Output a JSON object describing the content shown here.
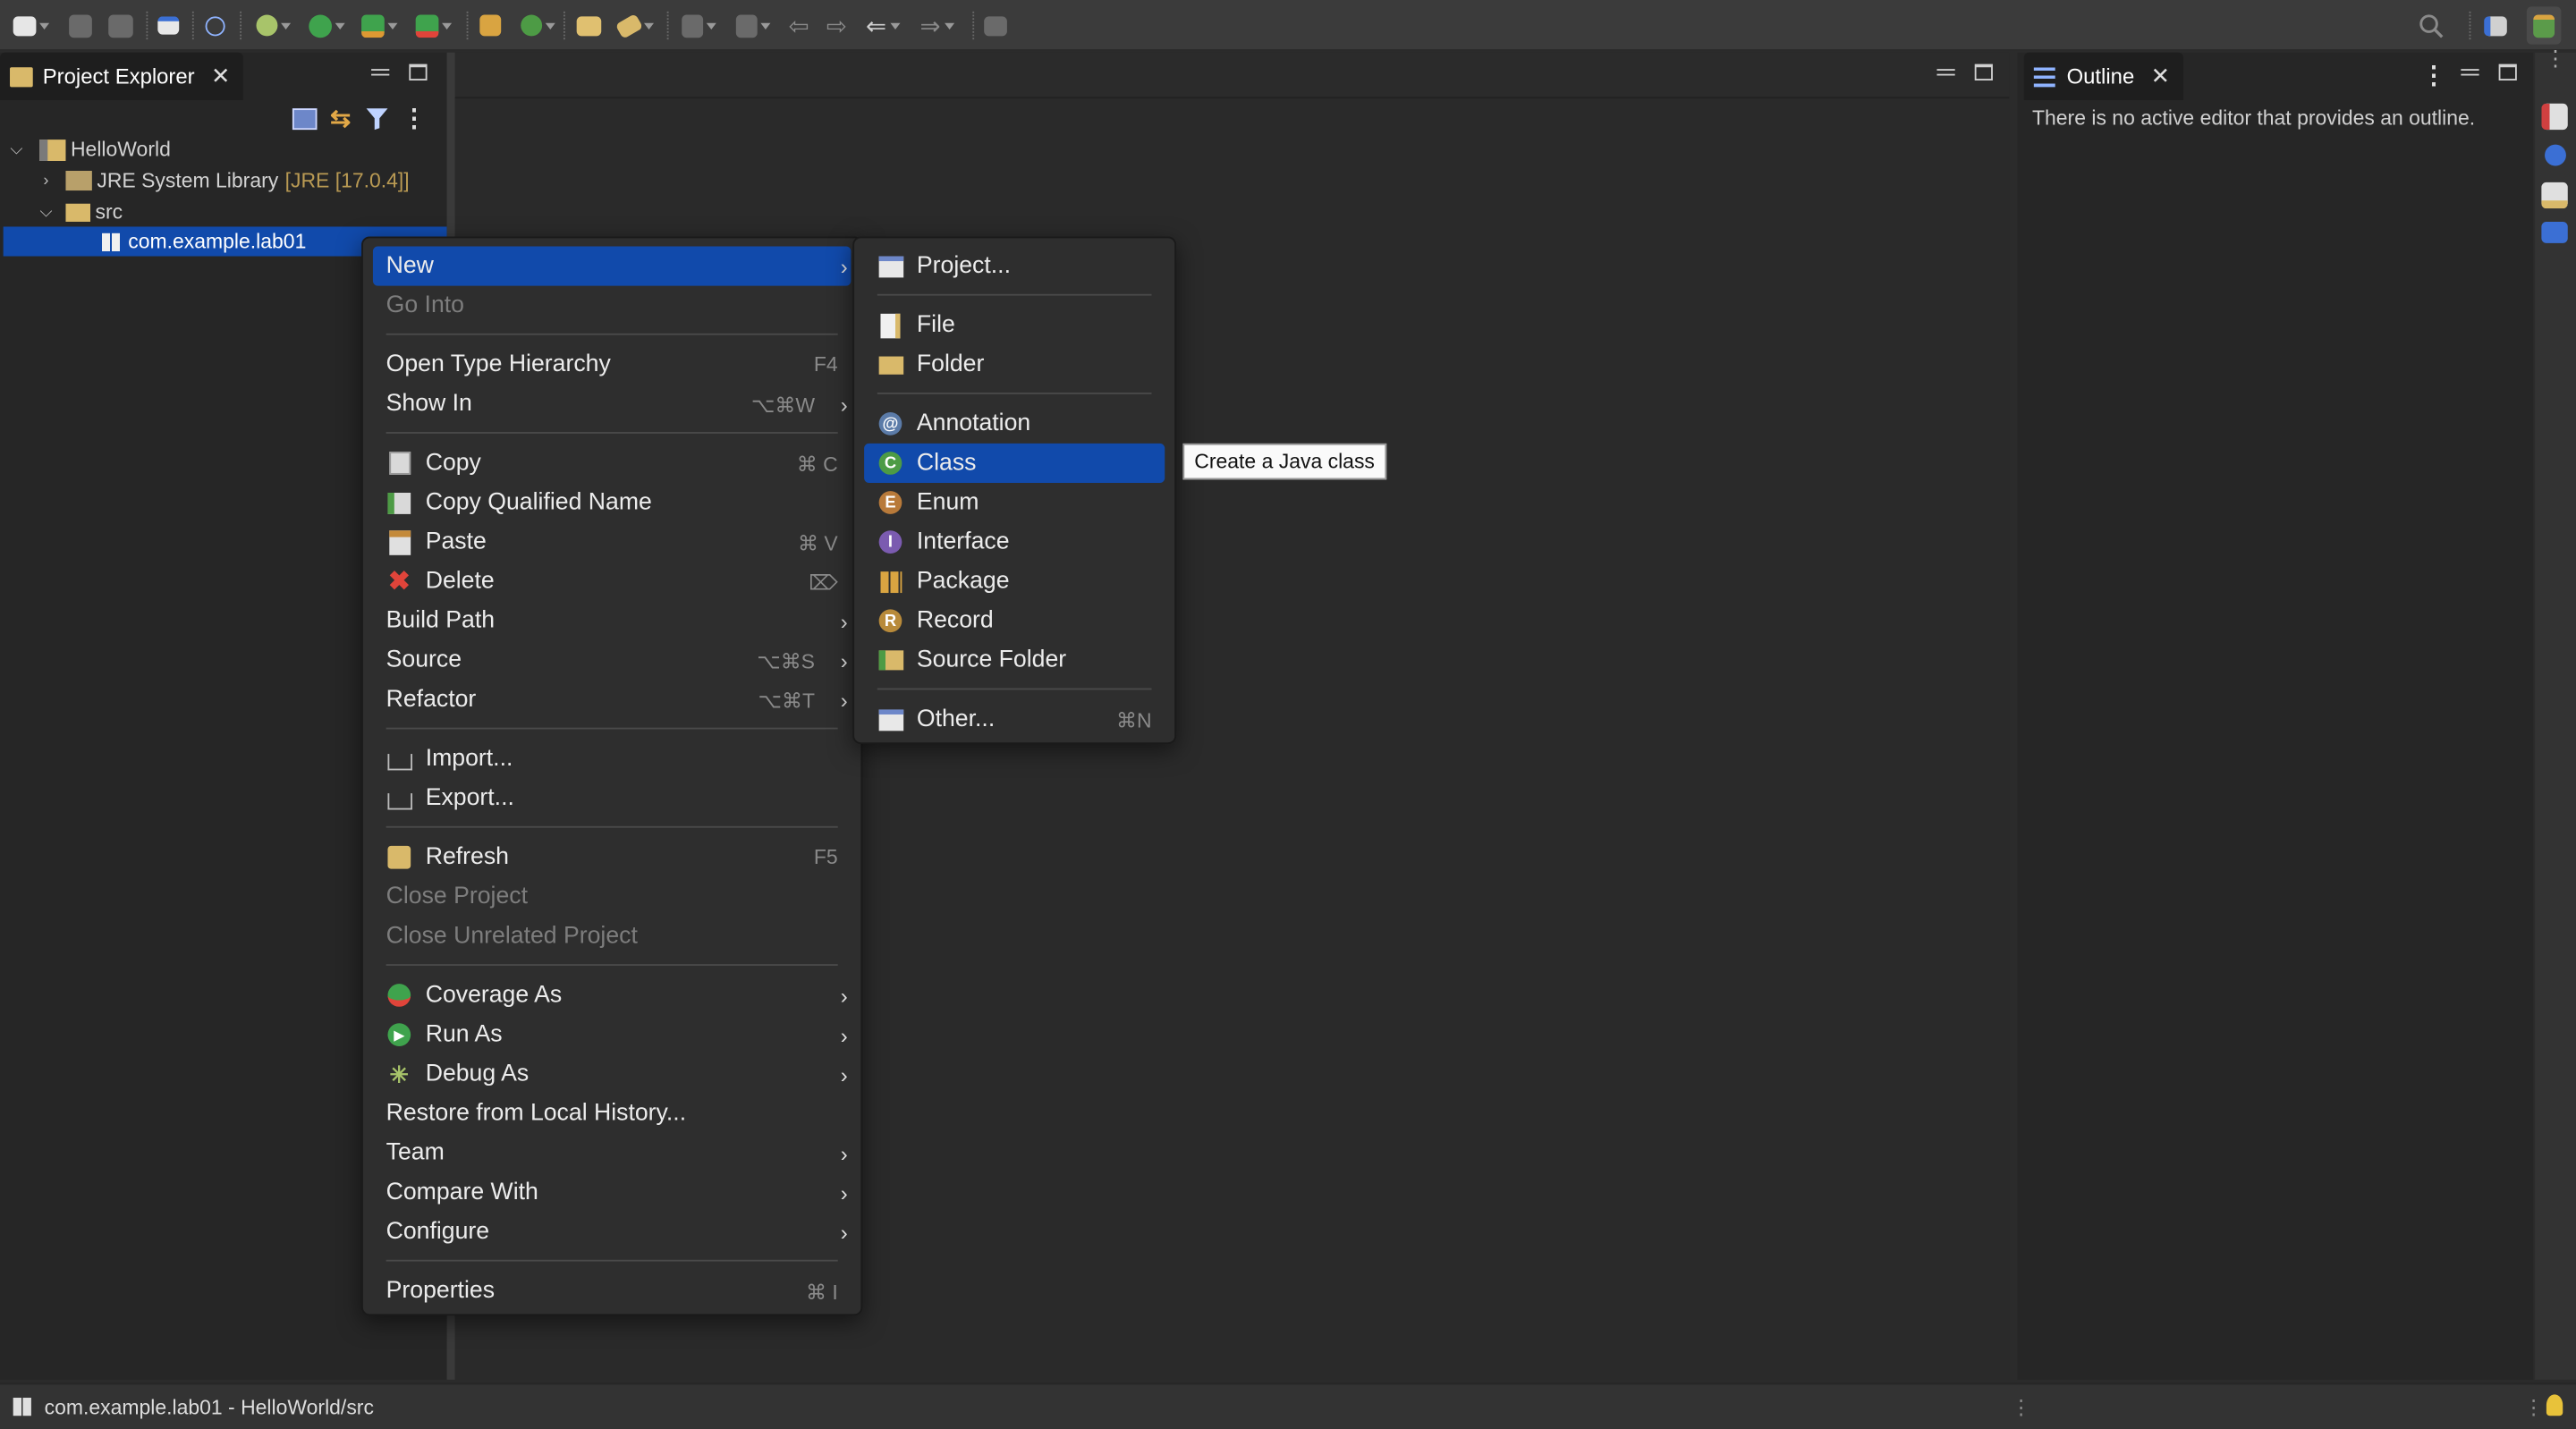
{
  "toolbar": {
    "icons": [
      "new-wizard-icon",
      "save-icon",
      "save-all-icon",
      "window-icon",
      "skip-breakpoints-icon",
      "debug-icon",
      "run-icon",
      "coverage-icon",
      "external-tools-icon",
      "new-java-package-icon",
      "new-java-class-icon",
      "open-type-icon",
      "search-icon-tool",
      "annotation-nav-icon",
      "next-annotation-icon",
      "back-icon",
      "forward-icon",
      "last-edit-icon",
      "pin-editor-icon"
    ]
  },
  "project_explorer": {
    "tab_label": "Project Explorer",
    "tree": [
      {
        "label": "HelloWorld",
        "extra": ""
      },
      {
        "label": "JRE System Library",
        "extra": "[JRE [17.0.4]]"
      },
      {
        "label": "src",
        "extra": ""
      },
      {
        "label": "com.example.lab01",
        "extra": ""
      }
    ]
  },
  "outline": {
    "tab_label": "Outline",
    "message": "There is no active editor that provides an outline."
  },
  "context_menu": {
    "new": "New",
    "go_into": "Go Into",
    "open_type_hierarchy": "Open Type Hierarchy",
    "open_type_hierarchy_sc": "F4",
    "show_in": "Show In",
    "show_in_sc": "⌥⌘W",
    "copy": "Copy",
    "copy_sc": "⌘ C",
    "copy_qualified": "Copy Qualified Name",
    "paste": "Paste",
    "paste_sc": "⌘ V",
    "delete": "Delete",
    "delete_sc": "⌦",
    "build_path": "Build Path",
    "source": "Source",
    "source_sc": "⌥⌘S",
    "refactor": "Refactor",
    "refactor_sc": "⌥⌘T",
    "import": "Import...",
    "export": "Export...",
    "refresh": "Refresh",
    "refresh_sc": "F5",
    "close_project": "Close Project",
    "close_unrelated": "Close Unrelated Project",
    "coverage_as": "Coverage As",
    "run_as": "Run As",
    "debug_as": "Debug As",
    "restore_history": "Restore from Local History...",
    "team": "Team",
    "compare_with": "Compare With",
    "configure": "Configure",
    "properties": "Properties",
    "properties_sc": "⌘ I"
  },
  "new_submenu": {
    "project": "Project...",
    "file": "File",
    "folder": "Folder",
    "annotation": "Annotation",
    "class": "Class",
    "enum": "Enum",
    "interface": "Interface",
    "package": "Package",
    "record": "Record",
    "source_folder": "Source Folder",
    "other": "Other...",
    "other_sc": "⌘N"
  },
  "tooltip": "Create a Java class",
  "status": {
    "text": "com.example.lab01 - HelloWorld/src"
  },
  "colors": {
    "selection": "#114aab",
    "background": "#2b2b2b",
    "panel": "#262626",
    "accent_green": "#3fa34d",
    "accent_red": "#e0443a"
  }
}
